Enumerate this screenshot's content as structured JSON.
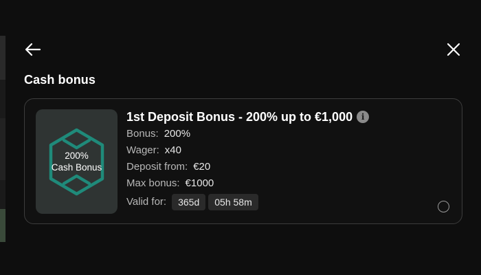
{
  "header": {
    "back_icon": "arrow-left-icon",
    "close_icon": "close-icon"
  },
  "section": {
    "title": "Cash bonus"
  },
  "bonus_card": {
    "thumbnail": {
      "line1": "200%",
      "line2": "Cash Bonus",
      "accent": "#1f8a7a"
    },
    "title": "1st Deposit Bonus - 200% up to €1,000",
    "info_icon": "info-icon",
    "bonus_label": "Bonus:",
    "bonus_value": "200%",
    "wager_label": "Wager:",
    "wager_value": "x40",
    "deposit_label": "Deposit from:",
    "deposit_value": "€20",
    "max_label": "Max bonus:",
    "max_value": "€1000",
    "valid_label": "Valid for:",
    "valid_days": "365d",
    "valid_time": "05h 58m",
    "selected": false
  }
}
